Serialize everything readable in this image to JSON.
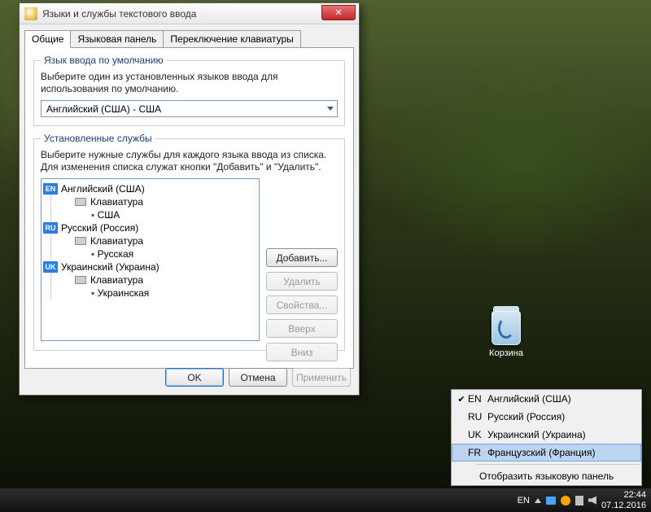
{
  "dialog": {
    "title": "Языки и службы текстового ввода",
    "tabs": [
      "Общие",
      "Языковая панель",
      "Переключение клавиатуры"
    ],
    "default_lang": {
      "legend": "Язык ввода по умолчанию",
      "desc": "Выберите один из установленных языков ввода для использования по умолчанию.",
      "value": "Английский (США) - США"
    },
    "services": {
      "legend": "Установленные службы",
      "desc": "Выберите нужные службы для каждого языка ввода из списка. Для изменения списка служат кнопки \"Добавить\" и \"Удалить\".",
      "keyboard_label": "Клавиатура",
      "langs": [
        {
          "code": "EN",
          "name": "Английский (США)",
          "layout": "США"
        },
        {
          "code": "RU",
          "name": "Русский (Россия)",
          "layout": "Русская"
        },
        {
          "code": "UK",
          "name": "Украинский (Украина)",
          "layout": "Украинская"
        }
      ],
      "buttons": {
        "add": "Добавить...",
        "remove": "Удалить",
        "props": "Свойства...",
        "up": "Вверх",
        "down": "Вниз"
      }
    },
    "footer": {
      "ok": "OK",
      "cancel": "Отмена",
      "apply": "Применить"
    }
  },
  "recycle_label": "Корзина",
  "lang_menu": {
    "items": [
      {
        "checked": true,
        "code": "EN",
        "name": "Английский (США)"
      },
      {
        "checked": false,
        "code": "RU",
        "name": "Русский (Россия)"
      },
      {
        "checked": false,
        "code": "UK",
        "name": "Украинский (Украина)"
      },
      {
        "checked": false,
        "code": "FR",
        "name": "Французский (Франция)",
        "hover": true
      }
    ],
    "show_panel": "Отобразить языковую панель"
  },
  "taskbar": {
    "lang": "EN",
    "time": "22:44",
    "date": "07.12.2016"
  }
}
